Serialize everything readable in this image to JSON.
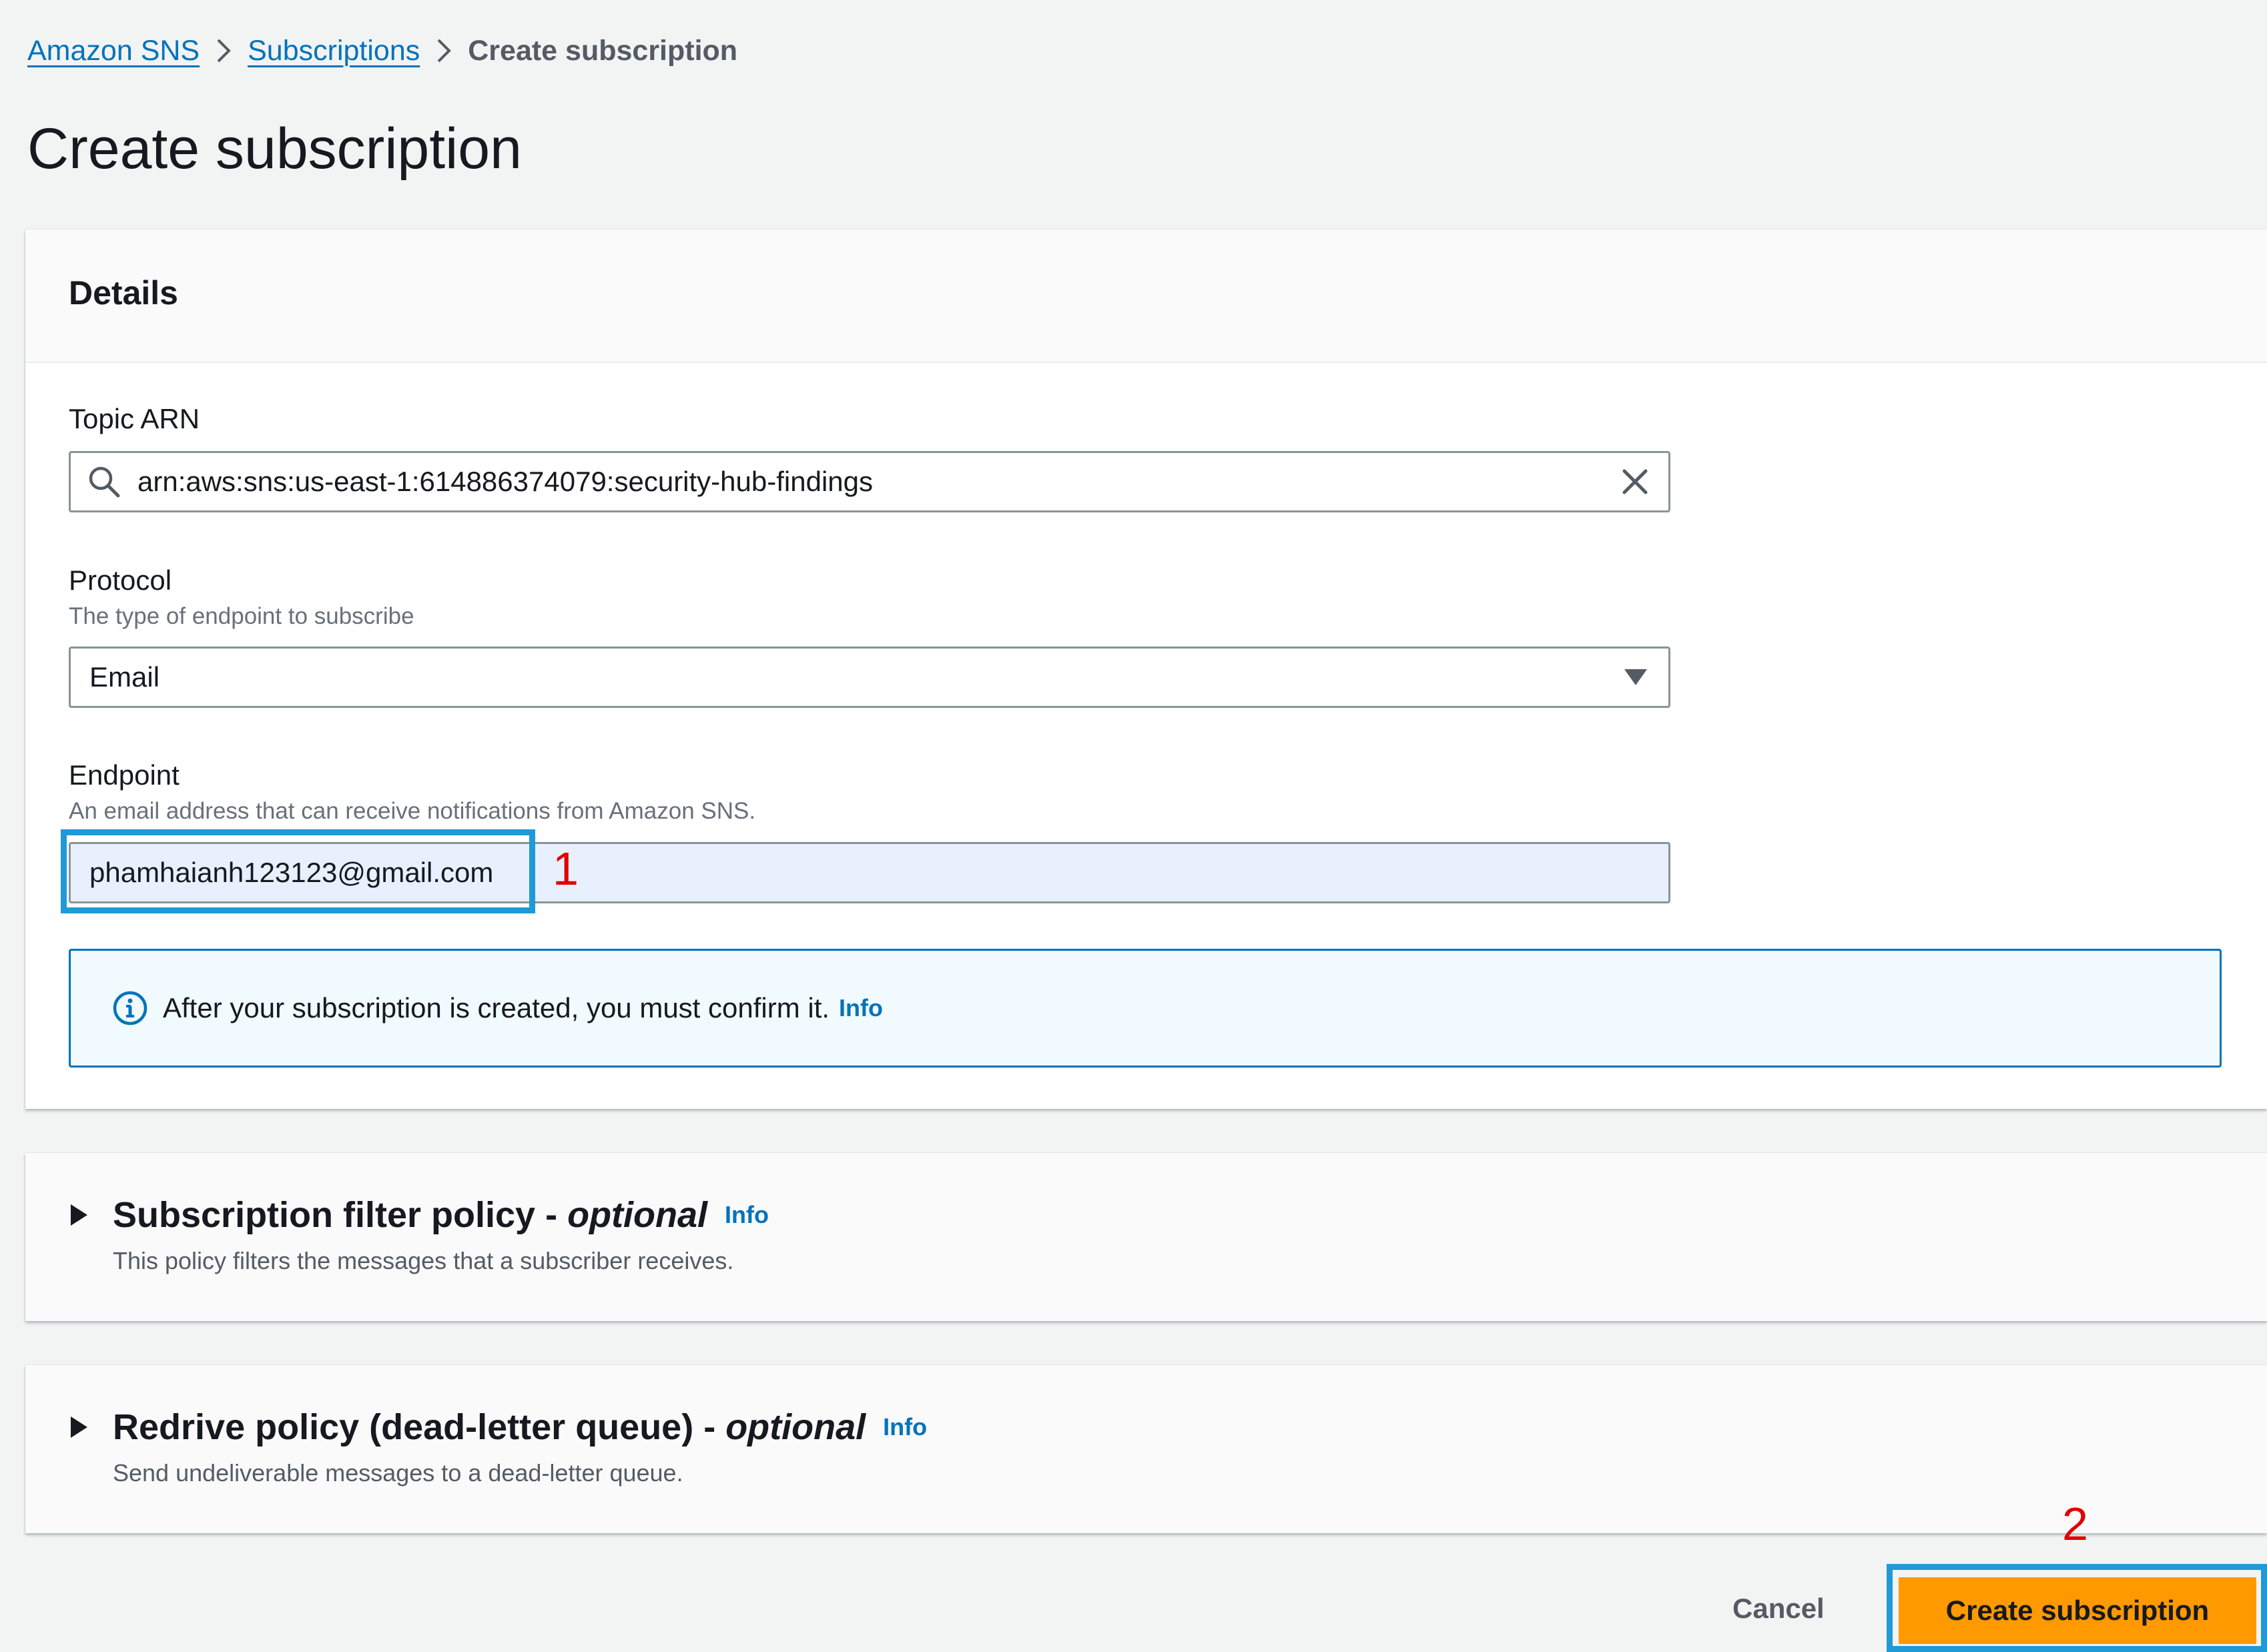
{
  "breadcrumb": {
    "items": [
      {
        "label": "Amazon SNS"
      },
      {
        "label": "Subscriptions"
      },
      {
        "label": "Create subscription"
      }
    ]
  },
  "page": {
    "title": "Create subscription"
  },
  "details": {
    "header": "Details",
    "topic_arn": {
      "label": "Topic ARN",
      "value": "arn:aws:sns:us-east-1:614886374079:security-hub-findings"
    },
    "protocol": {
      "label": "Protocol",
      "description": "The type of endpoint to subscribe",
      "selected": "Email"
    },
    "endpoint": {
      "label": "Endpoint",
      "description": "An email address that can receive notifications from Amazon SNS.",
      "value": "phamhaianh123123@gmail.com"
    },
    "alert": {
      "text": "After your subscription is created, you must confirm it.",
      "info_label": "Info"
    }
  },
  "filter_policy": {
    "title": "Subscription filter policy - ",
    "title_optional": "optional",
    "info_label": "Info",
    "description": "This policy filters the messages that a subscriber receives."
  },
  "redrive_policy": {
    "title": "Redrive policy (dead-letter queue) - ",
    "title_optional": "optional",
    "info_label": "Info",
    "description": "Send undeliverable messages to a dead-letter queue."
  },
  "footer": {
    "cancel_label": "Cancel",
    "create_label": "Create subscription"
  },
  "annotations": {
    "marker_1": "1",
    "marker_2": "2"
  },
  "icons": {
    "breadcrumb_separator": "chevron-right-icon",
    "search": "search-icon",
    "clear": "close-icon",
    "dropdown": "caret-down-icon",
    "info": "info-circle-icon",
    "expand": "caret-right-icon"
  },
  "colors": {
    "link": "#0073bb",
    "primary_button": "#ff9900",
    "annotation_box": "#1f9ad6",
    "annotation_marker": "#e00000",
    "alert_background": "#f1faff"
  }
}
